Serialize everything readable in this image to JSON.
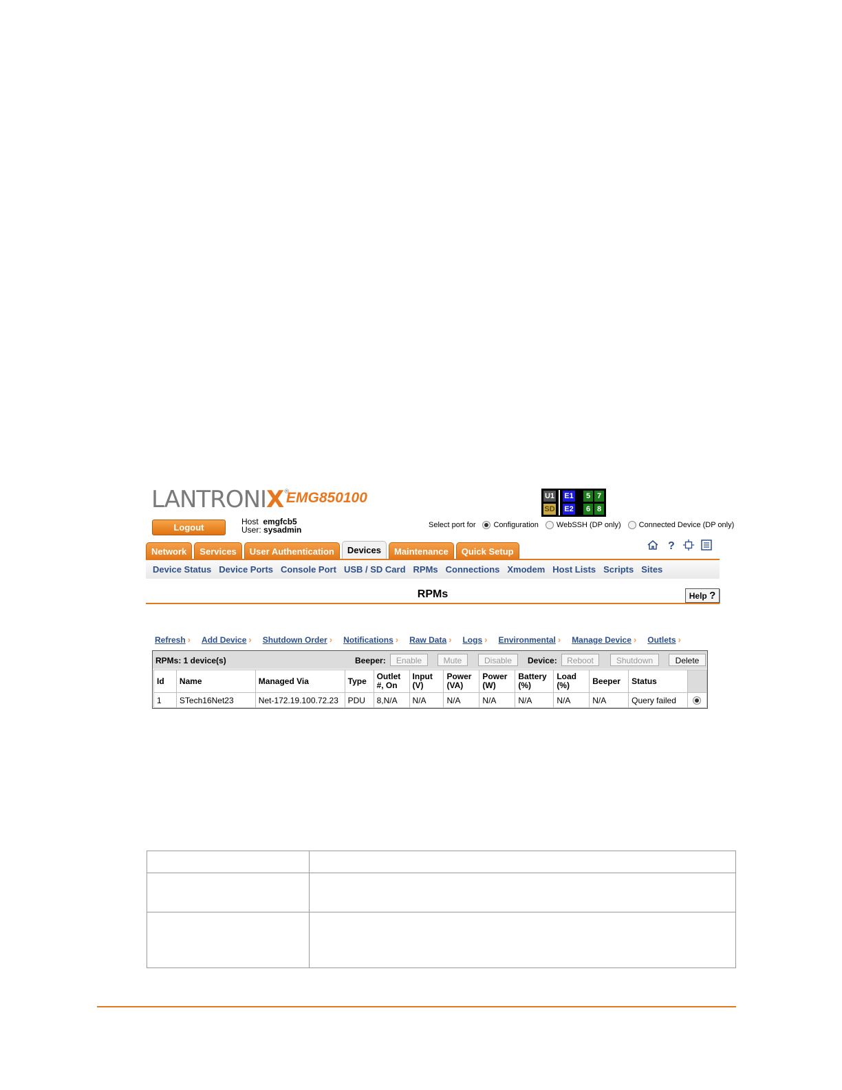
{
  "header": {
    "brand": {
      "main": "LANTRONI",
      "x": "X",
      "reg": "®"
    },
    "model": "EMG850100",
    "logout_label": "Logout",
    "host_label": "Host",
    "host_value": "emgfcb5",
    "user_label": "User:",
    "user_value": "sysadmin",
    "port_panel": {
      "u1": "U1",
      "sd": "SD",
      "e1": "E1",
      "e2": "E2",
      "p5": "5",
      "p7": "7",
      "p6": "6",
      "p8": "8"
    },
    "port_select": {
      "label": "Select port for",
      "options": [
        "Configuration",
        "WebSSH (DP only)",
        "Connected Device (DP only)"
      ],
      "selected": "Configuration"
    }
  },
  "tabs": [
    "Network",
    "Services",
    "User Authentication",
    "Devices",
    "Maintenance",
    "Quick Setup"
  ],
  "active_tab": "Devices",
  "toolbar_icons": [
    "home-icon",
    "help-icon",
    "sitemap-icon",
    "notes-icon"
  ],
  "subnav": [
    "Device Status",
    "Device Ports",
    "Console Port",
    "USB / SD Card",
    "RPMs",
    "Connections",
    "Xmodem",
    "Host Lists",
    "Scripts",
    "Sites"
  ],
  "page": {
    "title": "RPMs",
    "help_label": "Help"
  },
  "actions": [
    "Refresh",
    "Add Device",
    "Shutdown Order",
    "Notifications",
    "Raw Data",
    "Logs",
    "Environmental",
    "Manage Device",
    "Outlets"
  ],
  "rpm_table": {
    "count_label": "RPMs: 1 device(s)",
    "beeper_label": "Beeper:",
    "device_label": "Device:",
    "buttons": {
      "enable": "Enable",
      "mute": "Mute",
      "disable": "Disable",
      "reboot": "Reboot",
      "shutdown": "Shutdown",
      "delete": "Delete"
    },
    "columns": {
      "id": "Id",
      "name": "Name",
      "managed_via": "Managed Via",
      "type": "Type",
      "outlet_1": "Outlet",
      "outlet_2": "#, On",
      "input_1": "Input",
      "input_2": "(V)",
      "power_va_1": "Power",
      "power_va_2": "(VA)",
      "power_w_1": "Power",
      "power_w_2": "(W)",
      "battery_1": "Battery",
      "battery_2": "(%)",
      "load_1": "Load",
      "load_2": "(%)",
      "beeper": "Beeper",
      "status": "Status"
    },
    "rows": [
      {
        "id": "1",
        "name": "STech16Net23",
        "managed_via": "Net-172.19.100.72.23",
        "type": "PDU",
        "outlet": "8,N/A",
        "input": "N/A",
        "power_va": "N/A",
        "power_w": "N/A",
        "battery": "N/A",
        "load": "N/A",
        "beeper": "N/A",
        "status": "Query failed",
        "selected": true
      }
    ]
  },
  "colors": {
    "accent_orange": "#e2781a",
    "link_blue": "#2d4f8a"
  }
}
